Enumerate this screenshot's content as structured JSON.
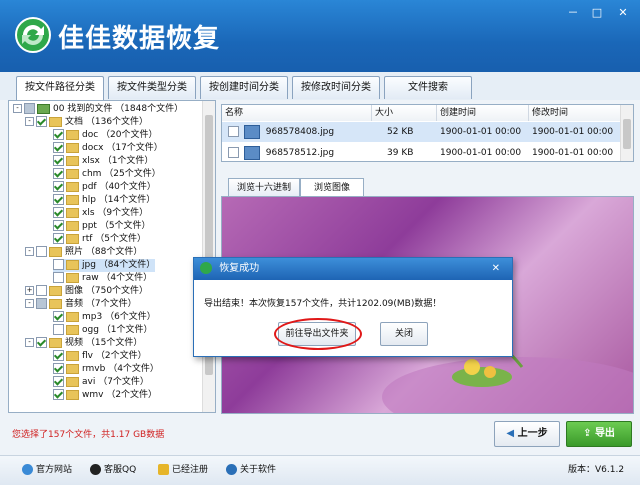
{
  "app": {
    "title": "佳佳数据恢复"
  },
  "window": {
    "minimize": "－",
    "maximize": "□",
    "close": "✕"
  },
  "tabs": [
    {
      "label": "按文件路径分类"
    },
    {
      "label": "按文件类型分类"
    },
    {
      "label": "按创建时间分类"
    },
    {
      "label": "按修改时间分类"
    },
    {
      "label": "文件搜索"
    }
  ],
  "tree": [
    {
      "text": "00 找到的文件   （1848个文件）"
    },
    {
      "text": "文档   （136个文件）"
    },
    {
      "text": "doc   （20个文件）"
    },
    {
      "text": "docx   （17个文件）"
    },
    {
      "text": "xlsx   （1个文件）"
    },
    {
      "text": "chm   （25个文件）"
    },
    {
      "text": "pdf   （40个文件）"
    },
    {
      "text": "hlp   （14个文件）"
    },
    {
      "text": "xls   （9个文件）"
    },
    {
      "text": "ppt   （5个文件）"
    },
    {
      "text": "rtf   （5个文件）"
    },
    {
      "text": "照片   （88个文件）"
    },
    {
      "text": "jpg   （84个文件）"
    },
    {
      "text": "raw   （4个文件）"
    },
    {
      "text": "图像   （750个文件）"
    },
    {
      "text": "音频   （7个文件）"
    },
    {
      "text": "mp3   （6个文件）"
    },
    {
      "text": "ogg   （1个文件）"
    },
    {
      "text": "视频   （15个文件）"
    },
    {
      "text": "flv   （2个文件）"
    },
    {
      "text": "rmvb   （4个文件）"
    },
    {
      "text": "avi   （7个文件）"
    },
    {
      "text": "wmv   （2个文件）"
    }
  ],
  "filelist": {
    "headers": {
      "name": "名称",
      "size": "大小",
      "created": "创建时间",
      "modified": "修改时间"
    },
    "rows": [
      {
        "name": "968578408.jpg",
        "size": "52 KB",
        "created": "1900-01-01 00:00",
        "modified": "1900-01-01 00:00"
      },
      {
        "name": "968578512.jpg",
        "size": "39 KB",
        "created": "1900-01-01 00:00",
        "modified": "1900-01-01 00:00"
      }
    ]
  },
  "subtabs": {
    "hex": "浏览十六进制",
    "image": "浏览图像"
  },
  "dialog": {
    "title": "恢复成功",
    "message": "导出结束！本次恢复157个文件，共计1202.09(MB)数据！",
    "open_folder": "前往导出文件夹",
    "close": "关闭",
    "close_x": "✕"
  },
  "status": {
    "selection": "您选择了157个文件，共1.17 GB数据"
  },
  "buttons": {
    "prev": "上一步",
    "export": "导出"
  },
  "footer": {
    "website": "官方网站",
    "qq": "客服QQ",
    "registered": "已经注册",
    "about": "关于软件",
    "version_label": "版本：",
    "version": "V6.1.2"
  },
  "colors": {
    "header": "#1a67b8",
    "accent_green": "#4cae3c",
    "status_red": "#d02020",
    "highlight_oval": "#e01818"
  }
}
